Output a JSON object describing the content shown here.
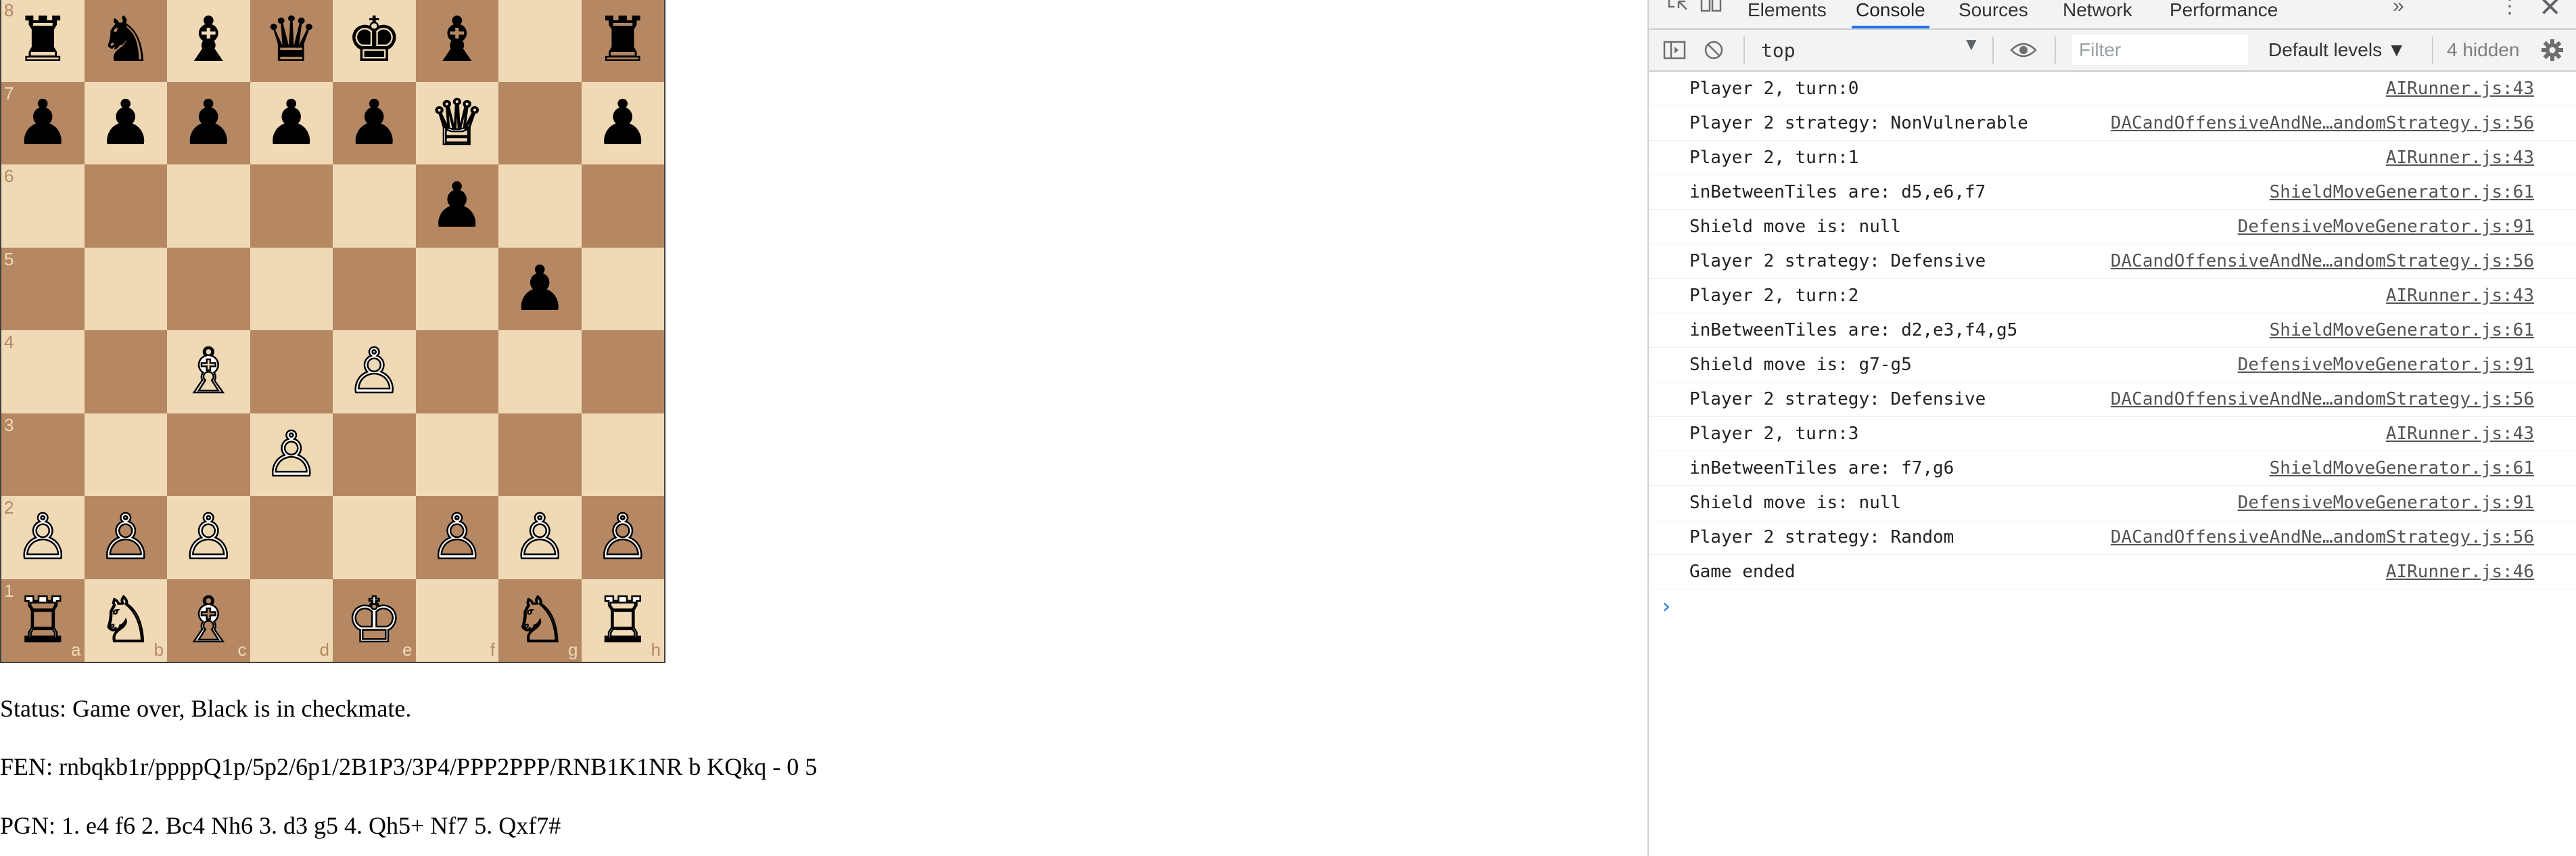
{
  "board": {
    "rows": [
      [
        "♜",
        "♞",
        "♝",
        "♛",
        "♚",
        "♝",
        "",
        "♜"
      ],
      [
        "♟",
        "♟",
        "♟",
        "♟",
        "♟",
        "♕",
        "",
        "♟"
      ],
      [
        "",
        "",
        "",
        "",
        "",
        "♟",
        "",
        ""
      ],
      [
        "",
        "",
        "",
        "",
        "",
        "",
        "♟",
        ""
      ],
      [
        "",
        "",
        "♗",
        "",
        "♙",
        "",
        "",
        ""
      ],
      [
        "",
        "",
        "",
        "♙",
        "",
        "",
        "",
        ""
      ],
      [
        "♙",
        "♙",
        "♙",
        "",
        "",
        "♙",
        "♙",
        "♙"
      ],
      [
        "♖",
        "♘",
        "♗",
        "",
        "♔",
        "",
        "♘",
        "♖"
      ]
    ],
    "ranks": [
      "8",
      "7",
      "6",
      "5",
      "4",
      "3",
      "2",
      "1"
    ],
    "files": [
      "a",
      "b",
      "c",
      "d",
      "e",
      "f",
      "g",
      "h"
    ]
  },
  "status_text": "Status: Game over, Black is in checkmate.",
  "fen_text": "FEN: rnbqkb1r/ppppQ1p/5p2/6p1/2B1P3/3P4/PPP2PPP/RNB1K1NR b KQkq - 0 5",
  "pgn_text": "PGN: 1. e4 f6 2. Bc4 Nh6 3. d3 g5 4. Qh5+ Nf7 5. Qxf7#",
  "devtools": {
    "tabs": [
      {
        "label": "Elements",
        "active": false
      },
      {
        "label": "Console",
        "active": true
      },
      {
        "label": "Sources",
        "active": false
      },
      {
        "label": "Network",
        "active": false
      },
      {
        "label": "Performance",
        "active": false
      }
    ],
    "more_tabs": "»",
    "kebab": "⋮",
    "close": "✕",
    "toolbar": {
      "context": "top",
      "filter_placeholder": "Filter",
      "levels": "Default levels ▼",
      "hidden": "4 hidden"
    },
    "accent_color": "#1a73e8",
    "logs": [
      {
        "msg": "Player 2, turn:0",
        "src": "AIRunner.js:43"
      },
      {
        "msg": "Player 2 strategy: NonVulnerable",
        "src": "DACandOffensiveAndNe…andomStrategy.js:56"
      },
      {
        "msg": "Player 2, turn:1",
        "src": "AIRunner.js:43"
      },
      {
        "msg": "inBetweenTiles are: d5,e6,f7",
        "src": "ShieldMoveGenerator.js:61"
      },
      {
        "msg": "Shield move is: null",
        "src": "DefensiveMoveGenerator.js:91"
      },
      {
        "msg": "Player 2 strategy: Defensive",
        "src": "DACandOffensiveAndNe…andomStrategy.js:56"
      },
      {
        "msg": "Player 2, turn:2",
        "src": "AIRunner.js:43"
      },
      {
        "msg": "inBetweenTiles are: d2,e3,f4,g5",
        "src": "ShieldMoveGenerator.js:61"
      },
      {
        "msg": "Shield move is: g7-g5",
        "src": "DefensiveMoveGenerator.js:91"
      },
      {
        "msg": "Player 2 strategy: Defensive",
        "src": "DACandOffensiveAndNe…andomStrategy.js:56"
      },
      {
        "msg": "Player 2, turn:3",
        "src": "AIRunner.js:43"
      },
      {
        "msg": "inBetweenTiles are: f7,g6",
        "src": "ShieldMoveGenerator.js:61"
      },
      {
        "msg": "Shield move is: null",
        "src": "DefensiveMoveGenerator.js:91"
      },
      {
        "msg": "Player 2 strategy: Random",
        "src": "DACandOffensiveAndNe…andomStrategy.js:56"
      },
      {
        "msg": "Game ended",
        "src": "AIRunner.js:46"
      }
    ],
    "prompt": "›"
  }
}
